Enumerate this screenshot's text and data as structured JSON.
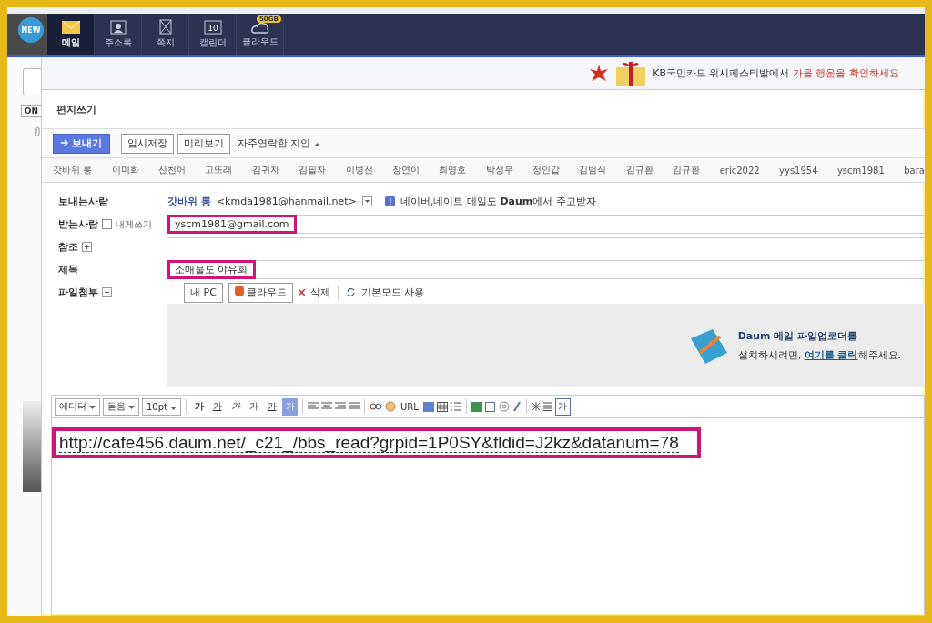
{
  "top_nav": {
    "badge": "NEW",
    "items": [
      {
        "label": "메일",
        "kind": "envelope",
        "selected": true
      },
      {
        "label": "주소록",
        "kind": "contact",
        "selected": false
      },
      {
        "label": "쪽지",
        "kind": "note",
        "selected": false
      },
      {
        "label": "캘린더",
        "kind": "calendar",
        "icon_text": "10",
        "selected": false
      },
      {
        "label": "클라우드",
        "kind": "cloud",
        "badge": "50GB",
        "selected": false
      }
    ]
  },
  "sidebar": {
    "button": "ON"
  },
  "banner": {
    "text": "KB국민카드 위시페스티발에서 ",
    "highlight": "가을 행운을 확인하세요"
  },
  "compose": {
    "title": "편지쓰기",
    "actions": {
      "send": "보내기",
      "save": "임시저장",
      "preview": "미리보기",
      "contacts": "자주연락한 지인"
    },
    "frequent_contacts": [
      "갓바위 롱",
      "이미화",
      "산천어",
      "고또래",
      "김귀자",
      "김필자",
      "이병선",
      "장연이",
      "최영호",
      "박성우",
      "정인갑",
      "김범식",
      "김규환",
      "김규환",
      "eric2022",
      "yys1954",
      "yscm1981",
      "bara"
    ],
    "from": {
      "label": "보내는사람",
      "name": "갓바위 롱",
      "email": "<kmda1981@hanmail.net>",
      "notice": "네이버,네이트 메일도 **Daum**에서 주고받자"
    },
    "to": {
      "label": "받는사람",
      "self": {
        "label": "내게쓰기",
        "checked": false
      },
      "value": "yscm1981@gmail.com",
      "highlighted": true
    },
    "cc": {
      "label": "참조"
    },
    "subject": {
      "label": "제목",
      "value": "소매물도 야유회",
      "highlighted": true
    },
    "attach": {
      "label": "파일첨부",
      "buttons": [
        "내 PC",
        "클라우드"
      ],
      "delete": "삭제",
      "basic_mode": "기본모드 사용"
    },
    "uploader": {
      "title": "Daum 메일 파일업로더를",
      "text": "설치하시려면, ",
      "link": "여기를 클릭",
      "tail": "해주세요."
    }
  },
  "editor": {
    "dropdowns": [
      "에디터",
      "돋움",
      "10pt"
    ],
    "format": [
      "가",
      "가",
      "가",
      "가",
      "가"
    ],
    "highlight_color": "가",
    "url": "URL",
    "last": "가",
    "body": "http://cafe456.daum.net/_c21_/bbs_read?grpid=1P0SY&fldid=J2kz&datanum=78",
    "highlighted": true
  }
}
